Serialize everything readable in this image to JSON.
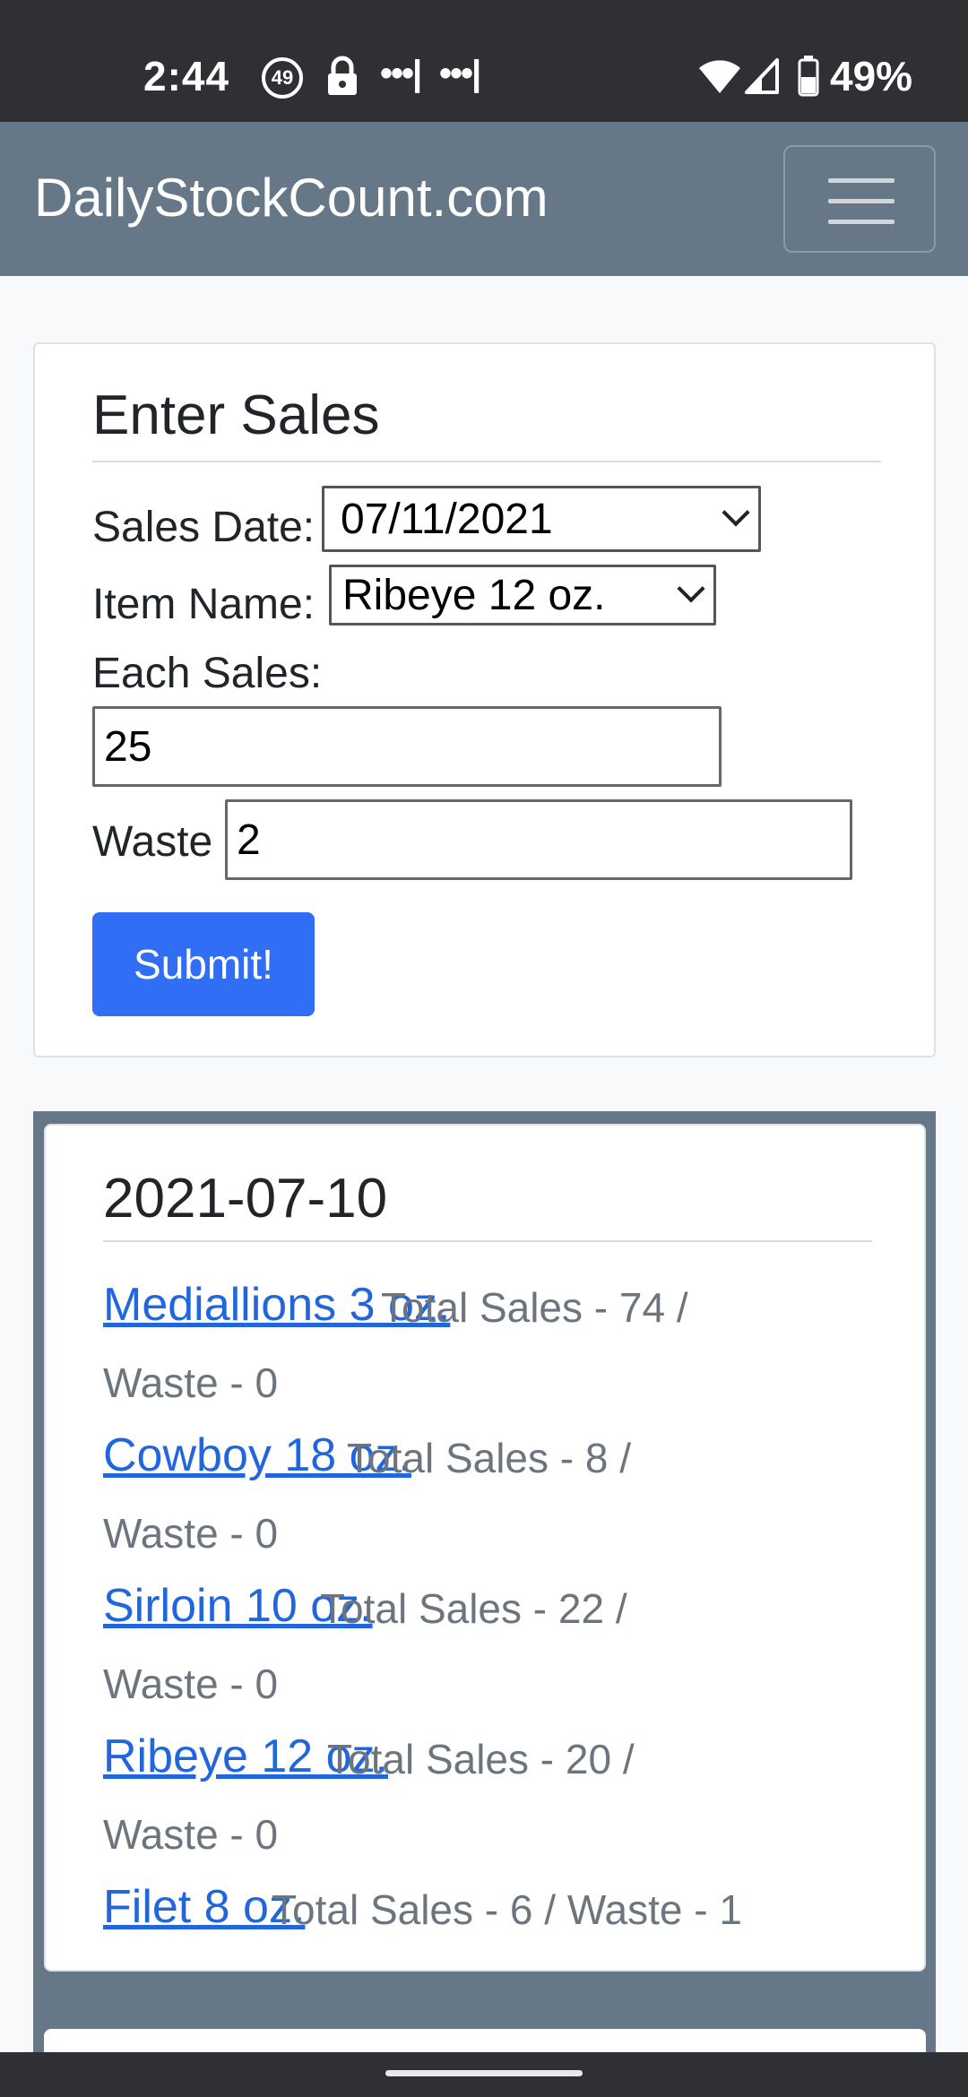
{
  "status_bar": {
    "time": "2:44",
    "notification_badge": "49",
    "dots_1": "•••|",
    "dots_2": "•••|",
    "battery": "49%",
    "icons": [
      "lock-icon",
      "wifi-icon",
      "signal-icon",
      "battery-icon"
    ]
  },
  "navbar": {
    "brand": "DailyStockCount.com",
    "menu_icon": "hamburger-menu-icon"
  },
  "sales_form": {
    "title": "Enter Sales",
    "date_label": "Sales Date:",
    "date_value": "07/11/2021",
    "item_label": "Item Name:",
    "item_value": "Ribeye 12 oz.",
    "each_sales_label": "Each Sales:",
    "each_sales_value": "25",
    "waste_label": "Waste",
    "waste_value": "2",
    "submit_label": "Submit!"
  },
  "results": {
    "date": "2021-07-10",
    "items": [
      {
        "name": "Mediallions 3 oz.",
        "summary_line1": "Total Sales - 74 /",
        "summary_line2": "Waste - 0"
      },
      {
        "name": "Cowboy 18 oz.",
        "summary_line1": "Total Sales - 8 /",
        "summary_line2": "Waste - 0"
      },
      {
        "name": "Sirloin 10 oz.",
        "summary_line1": "Total Sales - 22 /",
        "summary_line2": "Waste - 0"
      },
      {
        "name": "Ribeye 12 oz.",
        "summary_line1": "Total Sales - 20 /",
        "summary_line2": "Waste - 0"
      },
      {
        "name": "Filet 8 oz.",
        "summary_line1": "Total Sales - 6 / Waste - 1",
        "summary_line2": ""
      }
    ]
  },
  "colors": {
    "navbar_bg": "#667788",
    "primary_button": "#2f6ef5",
    "link": "#2266dd",
    "muted_text": "#6c757d"
  }
}
